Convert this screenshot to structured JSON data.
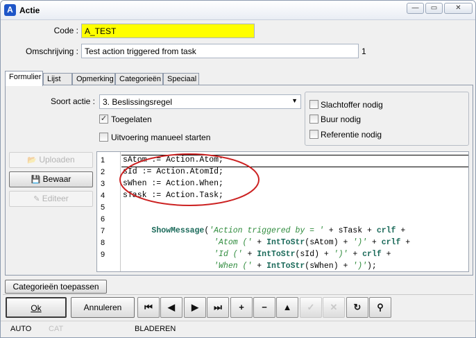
{
  "window": {
    "title": "Actie",
    "app_icon_glyph": "A",
    "minimize_glyph": "—",
    "maximize_glyph": "▭",
    "close_glyph": "✕"
  },
  "form": {
    "code_label": "Code :",
    "code_value": "A_TEST",
    "code_highlight_color": "#ffff00",
    "omschrijving_label": "Omschrijving :",
    "omschrijving_value": "Test action triggered from task",
    "omschrijving_count": "1"
  },
  "tabs": [
    "Formulier",
    "Lijst",
    "Opmerking",
    "Categorieën",
    "Speciaal"
  ],
  "formulier": {
    "soort_actie_label": "Soort actie :",
    "soort_actie_value": "3.  Beslissingsregel",
    "dropdown_arrow": "▼",
    "toegelaten_label": "Toegelaten",
    "toegelaten_checked": true,
    "check_mark": "✓",
    "uitvoering_label": "Uitvoering manueel starten",
    "uitvoering_checked": false,
    "slachtoffer_label": "Slachtoffer nodig",
    "buur_label": "Buur nodig",
    "referentie_label": "Referentie nodig"
  },
  "side_buttons": {
    "uploaden_label": "Uploaden",
    "bewaar_label": "Bewaar",
    "editeer_label": "Editeer",
    "uploaden_icon_glyph": "📂",
    "bewaar_icon_glyph": "💾",
    "editeer_icon_glyph": "✎"
  },
  "editor": {
    "line_numbers": [
      "1",
      "2",
      "3",
      "4",
      "5",
      "6",
      "7",
      "8",
      "9"
    ],
    "lines": [
      "sAtom := Action.Atom;",
      "sId := Action.AtomId;",
      "sWhen := Action.When;",
      "sTask := Action.Task;",
      "",
      [
        "ShowMessage",
        "(",
        "'Action triggered by = '",
        " + sTask + ",
        "crlf",
        " +"
      ],
      [
        "             ",
        "'Atom ('",
        " + ",
        "IntToStr",
        "(sAtom) + ",
        "')'",
        " + ",
        "crlf",
        " +"
      ],
      [
        "             ",
        "'Id ('",
        " + ",
        "IntToStr",
        "(sId) + ",
        "')'",
        " + ",
        "crlf",
        " +"
      ],
      [
        "             ",
        "'When ('",
        " + ",
        "IntToStr",
        "(sWhen) + ",
        "')'",
        ");"
      ]
    ],
    "annotation_color": "#cc2222"
  },
  "bottom": {
    "categorieen_button": "Categorieën toepassen",
    "ok_label": "Ok",
    "annuleren_label": "Annuleren",
    "nav": [
      {
        "name": "first-record-icon",
        "glyph": "⏮",
        "enabled": true
      },
      {
        "name": "prior-record-icon",
        "glyph": "◀",
        "enabled": true
      },
      {
        "name": "next-record-icon",
        "glyph": "▶",
        "enabled": true
      },
      {
        "name": "last-record-icon",
        "glyph": "⏭",
        "enabled": true
      },
      {
        "name": "insert-record-icon",
        "glyph": "+",
        "enabled": true
      },
      {
        "name": "delete-record-icon",
        "glyph": "−",
        "enabled": true
      },
      {
        "name": "edit-record-icon",
        "glyph": "▲",
        "enabled": true
      },
      {
        "name": "post-record-icon",
        "glyph": "✓",
        "enabled": false
      },
      {
        "name": "cancel-record-icon",
        "glyph": "✕",
        "enabled": false
      },
      {
        "name": "refresh-icon",
        "glyph": "↻",
        "enabled": true
      },
      {
        "name": "binoculars-icon",
        "glyph": "⚲",
        "enabled": true
      }
    ]
  },
  "statusbar": {
    "auto": "AUTO",
    "cat": "CAT",
    "mode": "BLADEREN"
  }
}
